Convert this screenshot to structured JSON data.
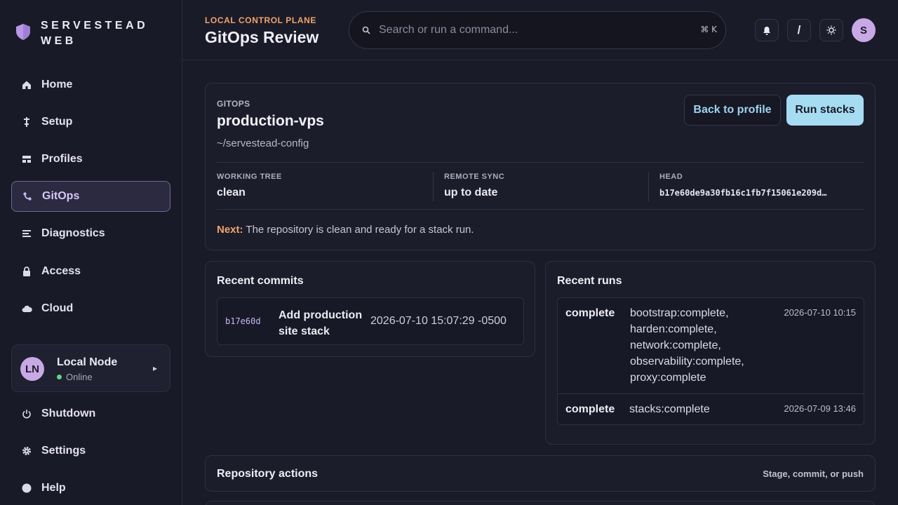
{
  "brand": {
    "name": "SERVESTEAD WEB"
  },
  "sidebar": {
    "items": [
      {
        "label": "Home",
        "icon": "home-icon"
      },
      {
        "label": "Setup",
        "icon": "setup-icon"
      },
      {
        "label": "Profiles",
        "icon": "profiles-icon"
      },
      {
        "label": "GitOps",
        "icon": "gitops-icon",
        "active": true
      },
      {
        "label": "Diagnostics",
        "icon": "diagnostics-icon"
      },
      {
        "label": "Access",
        "icon": "lock-icon"
      },
      {
        "label": "Cloud",
        "icon": "cloud-icon"
      }
    ],
    "node": {
      "initials": "LN",
      "name": "Local Node",
      "status": "Online"
    },
    "bottom_items": [
      {
        "label": "Shutdown",
        "icon": "power-icon"
      },
      {
        "label": "Settings",
        "icon": "gear-icon"
      },
      {
        "label": "Help",
        "icon": "help-icon"
      }
    ]
  },
  "header": {
    "eyebrow": "LOCAL CONTROL PLANE",
    "title": "GitOps Review",
    "search_placeholder": "Search or run a command...",
    "search_shortcut": "⌘ K",
    "slash_label": "/",
    "user_initial": "S"
  },
  "repo": {
    "label": "GITOPS",
    "name": "production-vps",
    "path": "~/servestead-config",
    "back_label": "Back to profile",
    "run_label": "Run stacks",
    "stats": {
      "working_tree_label": "WORKING TREE",
      "working_tree_value": "clean",
      "remote_sync_label": "REMOTE SYNC",
      "remote_sync_value": "up to date",
      "head_label": "HEAD",
      "head_value": "b17e60de9a30fb16c1fb7f15061e209d…"
    },
    "next_label": "Next:",
    "next_text": " The repository is clean and ready for a stack run."
  },
  "commits": {
    "title": "Recent commits",
    "items": [
      {
        "hash": "b17e60d",
        "message_line1": "Add production",
        "message_line2": "site stack",
        "date": "2026-07-10 15:07:29 -0500"
      }
    ]
  },
  "runs": {
    "title": "Recent runs",
    "items": [
      {
        "status": "complete",
        "details": [
          "bootstrap:complete,",
          "harden:complete,",
          "network:complete,",
          "observability:complete,",
          "proxy:complete"
        ],
        "time": "2026-07-10 10:15"
      },
      {
        "status": "complete",
        "details": [
          "stacks:complete"
        ],
        "time": "2026-07-09 13:46"
      }
    ]
  },
  "actions": {
    "title": "Repository actions",
    "hint": "Stage, commit, or push"
  },
  "colors": {
    "accent": "#a6dcf2",
    "eyebrow": "#f0a46a",
    "active_nav": "#d7c8f6",
    "online": "#5fd487"
  }
}
